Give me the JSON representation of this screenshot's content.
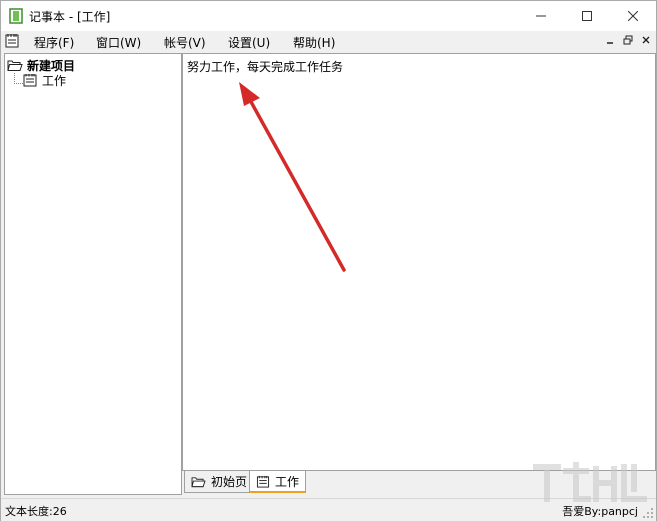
{
  "window": {
    "title": "记事本 - [工作]"
  },
  "controls": {
    "minimize": "minimize",
    "maximize": "maximize",
    "close": "close"
  },
  "menu": {
    "items": [
      {
        "label": "程序(F)"
      },
      {
        "label": "窗口(W)"
      },
      {
        "label": "帐号(V)"
      },
      {
        "label": "设置(U)"
      },
      {
        "label": "帮助(H)"
      }
    ]
  },
  "tree": {
    "root": {
      "label": "新建项目",
      "icon": "folder-icon"
    },
    "children": [
      {
        "label": "工作",
        "icon": "notepad-icon"
      }
    ]
  },
  "editor": {
    "content": "努力工作，每天完成工作任务"
  },
  "tabs": [
    {
      "label": "初始页",
      "icon": "folder-icon",
      "active": false
    },
    {
      "label": "工作",
      "icon": "notepad-icon",
      "active": true
    }
  ],
  "status": {
    "left": "文本长度:26",
    "right": "吾爱By:panpcj"
  },
  "colors": {
    "arrow": "#d42a2a",
    "tab_accent": "#f0a020"
  }
}
